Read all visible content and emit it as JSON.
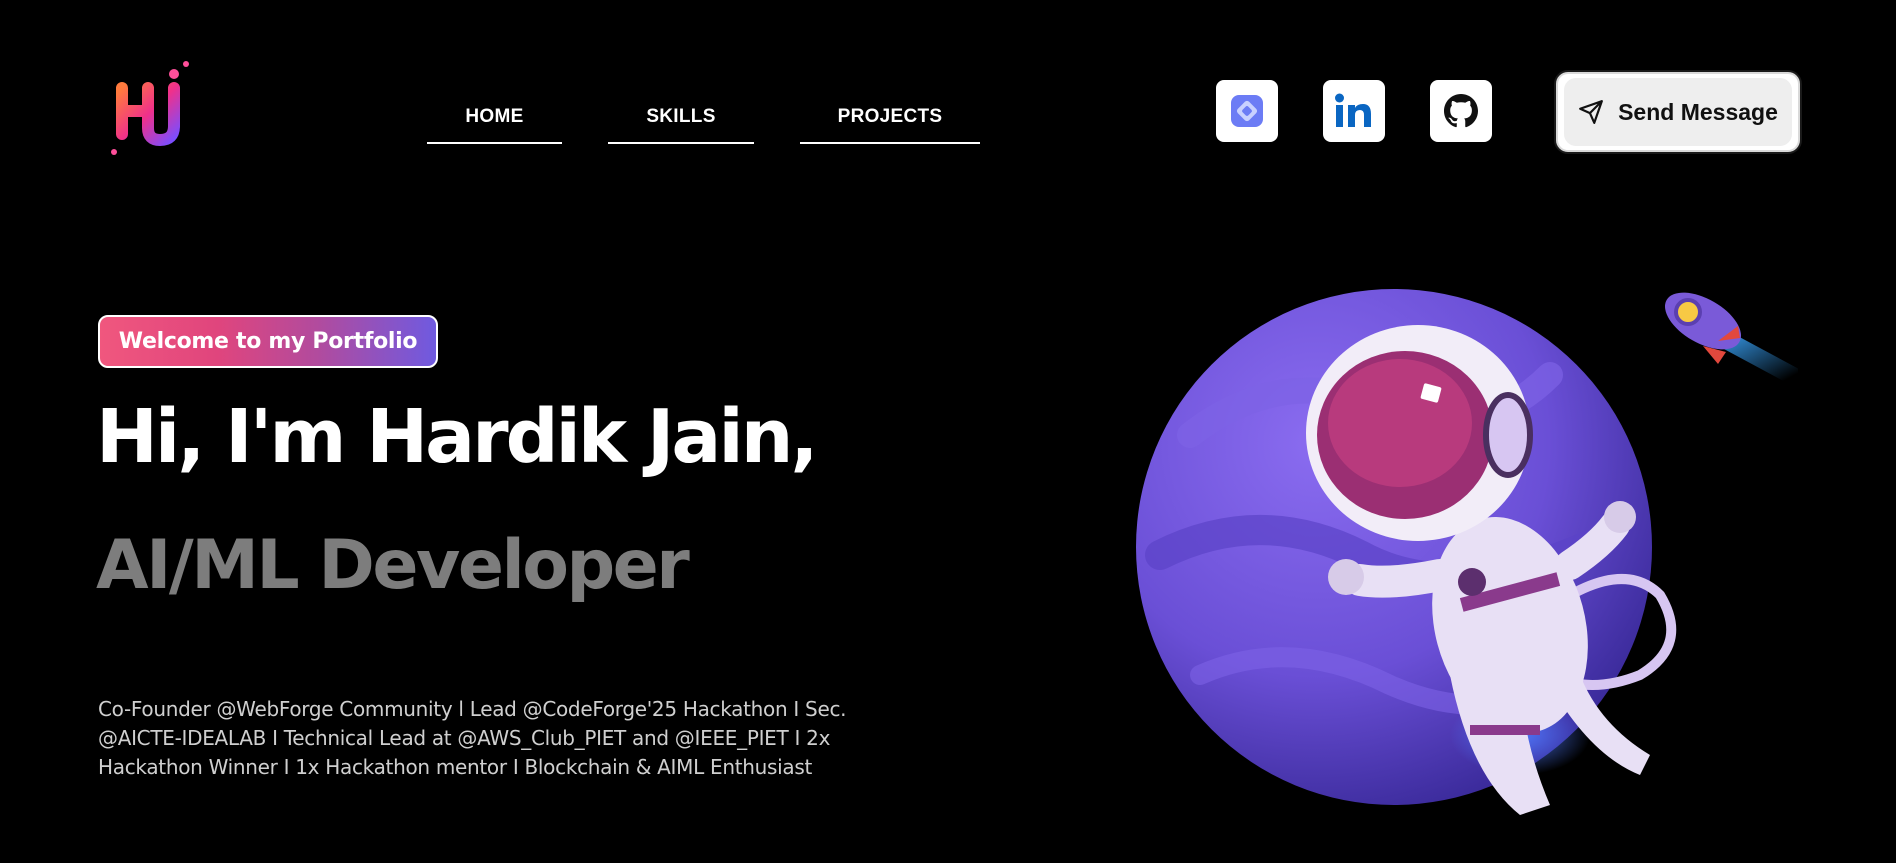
{
  "header": {
    "logo_text": "HJ",
    "nav": [
      {
        "label": "HOME"
      },
      {
        "label": "SKILLS"
      },
      {
        "label": "PROJECTS"
      }
    ],
    "socials": [
      {
        "icon": "portfolio-app-icon"
      },
      {
        "icon": "linkedin-icon"
      },
      {
        "icon": "github-icon"
      }
    ],
    "send_message_label": "Send Message"
  },
  "hero": {
    "badge": "Welcome to my Portfolio",
    "title": "Hi, I'm Hardik Jain,",
    "role": "AI/ML Developer",
    "bio": "Co-Founder @WebForge Community l Lead @CodeForge'25 Hackathon I Sec. @AICTE-IDEALAB I Technical Lead at @AWS_Club_PIET and @IEEE_PIET I 2x Hackathon Winner I 1x Hackathon mentor I Blockchain & AIML Enthusiast"
  },
  "colors": {
    "background": "#000000",
    "badge_gradient_start": "#f0577e",
    "badge_gradient_end": "#6f5ae0",
    "role_text": "#7d7d7d",
    "planet": "#6a4fd6",
    "linkedin": "#0a66c2"
  }
}
